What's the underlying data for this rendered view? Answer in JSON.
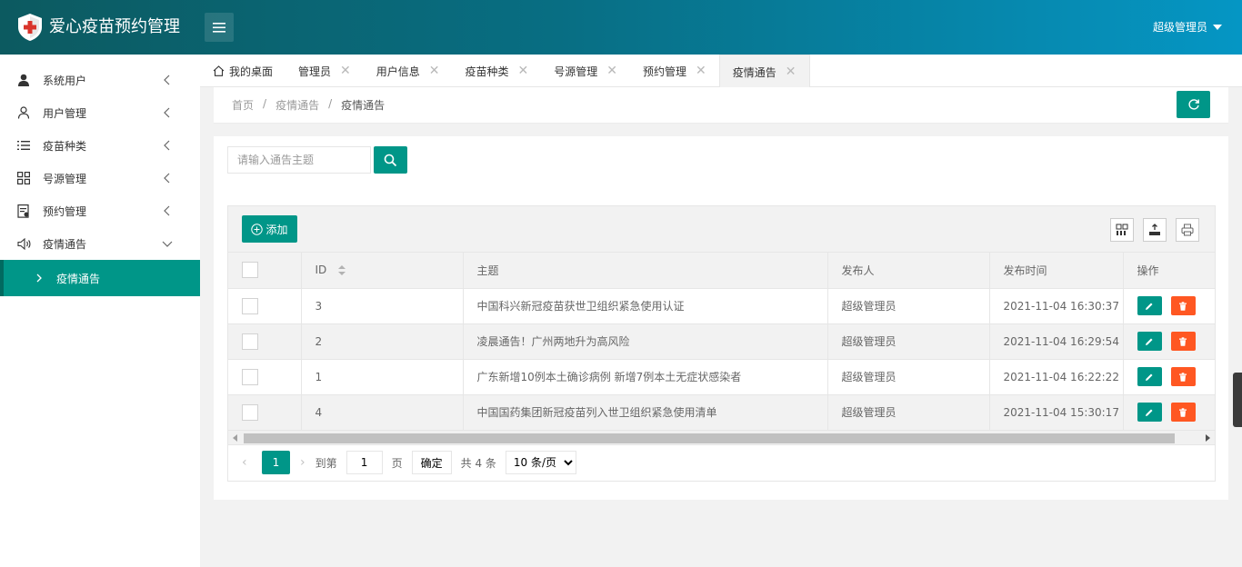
{
  "app": {
    "title": "爱心疫苗预约管理",
    "user": "超级管理员"
  },
  "colors": {
    "primary": "#009688",
    "danger": "#ff5722",
    "header_start": "#0c5a60",
    "header_end": "#0596c4"
  },
  "sidebar": {
    "items": [
      {
        "label": "系统用户",
        "icon": "user-solid-icon"
      },
      {
        "label": "用户管理",
        "icon": "user-outline-icon"
      },
      {
        "label": "疫苗种类",
        "icon": "list-icon"
      },
      {
        "label": "号源管理",
        "icon": "grid-icon"
      },
      {
        "label": "预约管理",
        "icon": "form-icon"
      },
      {
        "label": "疫情通告",
        "icon": "speaker-icon"
      }
    ],
    "sub_item": "疫情通告"
  },
  "tabs": [
    {
      "label": "我的桌面"
    },
    {
      "label": "管理员"
    },
    {
      "label": "用户信息"
    },
    {
      "label": "疫苗种类"
    },
    {
      "label": "号源管理"
    },
    {
      "label": "预约管理"
    },
    {
      "label": "疫情通告"
    }
  ],
  "breadcrumb": [
    "首页",
    "/",
    "疫情通告",
    "/",
    "疫情通告"
  ],
  "search": {
    "placeholder": "请输入通告主题"
  },
  "toolbar": {
    "add_label": "添加"
  },
  "table": {
    "headers": {
      "id": "ID",
      "subject": "主题",
      "publisher": "发布人",
      "time": "发布时间",
      "actions": "操作"
    },
    "rows": [
      {
        "id": "3",
        "subject": "中国科兴新冠疫苗获世卫组织紧急使用认证",
        "publisher": "超级管理员",
        "time": "2021-11-04 16:30:37"
      },
      {
        "id": "2",
        "subject": "凌晨通告！广州两地升为高风险",
        "publisher": "超级管理员",
        "time": "2021-11-04 16:29:54"
      },
      {
        "id": "1",
        "subject": "广东新增10例本土确诊病例 新增7例本土无症状感染者",
        "publisher": "超级管理员",
        "time": "2021-11-04 16:22:22"
      },
      {
        "id": "4",
        "subject": "中国国药集团新冠疫苗列入世卫组织紧急使用清单",
        "publisher": "超级管理员",
        "time": "2021-11-04 15:30:17"
      }
    ]
  },
  "pager": {
    "current": "1",
    "goto_label": "到第",
    "page_input": "1",
    "page_unit": "页",
    "confirm": "确定",
    "total": "共 4 条",
    "size": "10 条/页"
  }
}
